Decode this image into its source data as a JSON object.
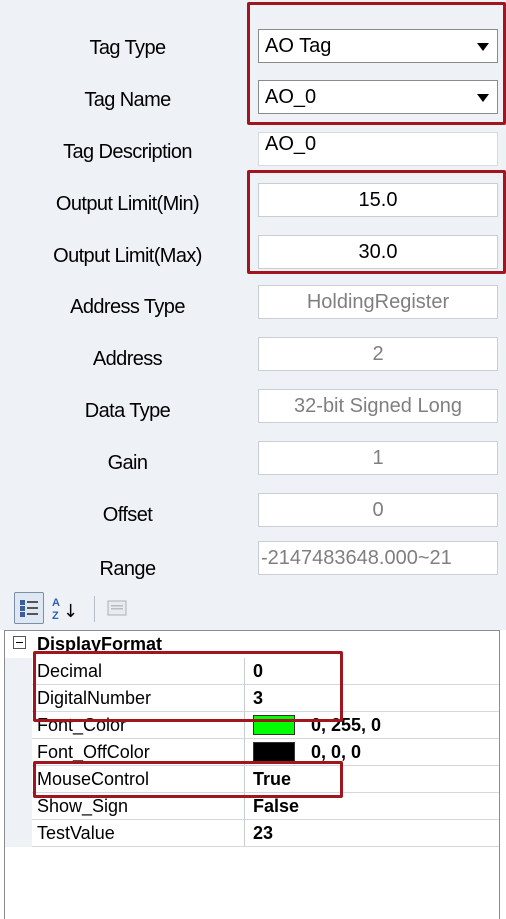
{
  "form": {
    "tag_type": {
      "label": "Tag Type",
      "value": "AO Tag"
    },
    "tag_name": {
      "label": "Tag Name",
      "value": "AO_0"
    },
    "tag_description": {
      "label": "Tag Description",
      "value": "AO_0"
    },
    "output_limit_min": {
      "label": "Output Limit(Min)",
      "value": "15.0"
    },
    "output_limit_max": {
      "label": "Output Limit(Max)",
      "value": "30.0"
    },
    "address_type": {
      "label": "Address Type",
      "value": "HoldingRegister"
    },
    "address": {
      "label": "Address",
      "value": "2"
    },
    "data_type": {
      "label": "Data Type",
      "value": "32-bit Signed Long"
    },
    "gain": {
      "label": "Gain",
      "value": "1"
    },
    "offset": {
      "label": "Offset",
      "value": "0"
    },
    "range": {
      "label": "Range",
      "value": "-2147483648.000~21"
    }
  },
  "toolbar": {
    "az_glyph_top": "A",
    "az_glyph_bottom": "Z",
    "az_arrow": "↓"
  },
  "property_grid": {
    "category": "DisplayFormat",
    "properties": [
      {
        "name": "Decimal",
        "value": "0"
      },
      {
        "name": "DigitalNumber",
        "value": "3"
      },
      {
        "name": "Font_Color",
        "value": "0, 255, 0",
        "swatch": "#00ff00"
      },
      {
        "name": "Font_OffColor",
        "value": "0, 0, 0",
        "swatch": "#000000"
      },
      {
        "name": "MouseControl",
        "value": "True"
      },
      {
        "name": "Show_Sign",
        "value": "False"
      },
      {
        "name": "TestValue",
        "value": "23"
      }
    ]
  },
  "colors": {
    "highlight": "#a3151e",
    "panel_background": "#eef2f7"
  }
}
